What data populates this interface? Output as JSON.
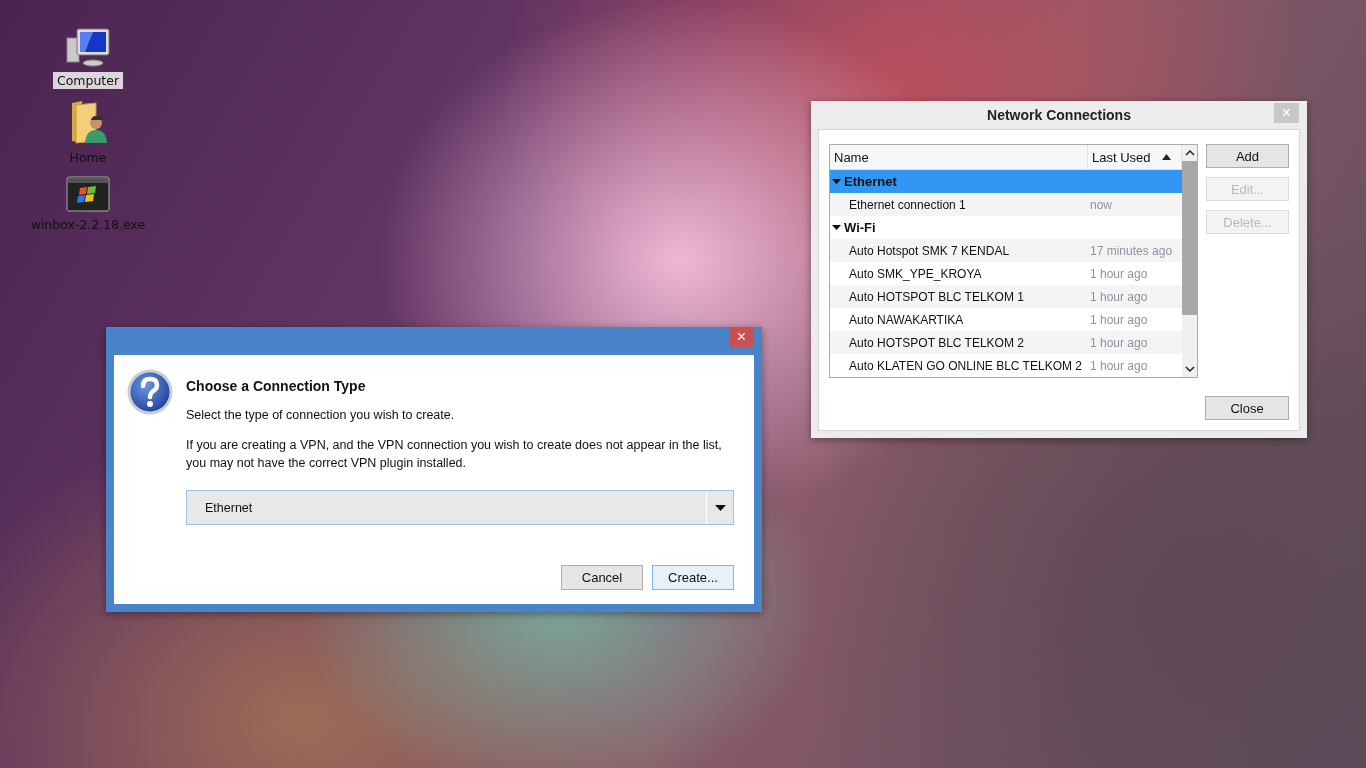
{
  "desktop_icons": [
    {
      "label": "Computer",
      "kind": "computer",
      "selected": true
    },
    {
      "label": "Home",
      "kind": "home",
      "selected": false
    },
    {
      "label": "winbox-2.2.18.exe",
      "kind": "exe",
      "selected": false
    }
  ],
  "network_connections": {
    "title": "Network Connections",
    "close": "×",
    "columns": [
      {
        "label": "Name",
        "sorted": false
      },
      {
        "label": "Last Used",
        "sorted": true
      }
    ],
    "groups": [
      {
        "name": "Ethernet",
        "expanded": true,
        "selected": true,
        "children": [
          {
            "name": "Ethernet connection 1",
            "last_used": "now"
          }
        ]
      },
      {
        "name": "Wi-Fi",
        "expanded": true,
        "selected": false,
        "children": [
          {
            "name": "Auto Hotspot SMK 7 KENDAL",
            "last_used": "17 minutes ago"
          },
          {
            "name": "Auto SMK_YPE_KROYA",
            "last_used": "1 hour ago"
          },
          {
            "name": "Auto HOTSPOT BLC TELKOM 1",
            "last_used": "1 hour ago"
          },
          {
            "name": "Auto NAWAKARTIKA",
            "last_used": "1 hour ago"
          },
          {
            "name": "Auto HOTSPOT BLC TELKOM 2",
            "last_used": "1 hour ago"
          },
          {
            "name": "Auto KLATEN GO ONLINE BLC TELKOM 2",
            "last_used": "1 hour ago"
          }
        ]
      }
    ],
    "buttons": [
      {
        "label": "Add",
        "disabled": false
      },
      {
        "label": "Edit...",
        "disabled": true
      },
      {
        "label": "Delete...",
        "disabled": true
      }
    ],
    "close_button": "Close"
  },
  "dialog": {
    "close": "×",
    "heading": "Choose a Connection Type",
    "text": "Select the type of connection you wish to create.",
    "note": "If you are creating a VPN, and the VPN connection you wish to create does not appear in the list, you may not have the correct VPN plugin installed.",
    "dropdown": {
      "value": "Ethernet"
    },
    "buttons": [
      {
        "label": "Cancel",
        "default": false
      },
      {
        "label": "Create...",
        "default": true
      }
    ]
  }
}
